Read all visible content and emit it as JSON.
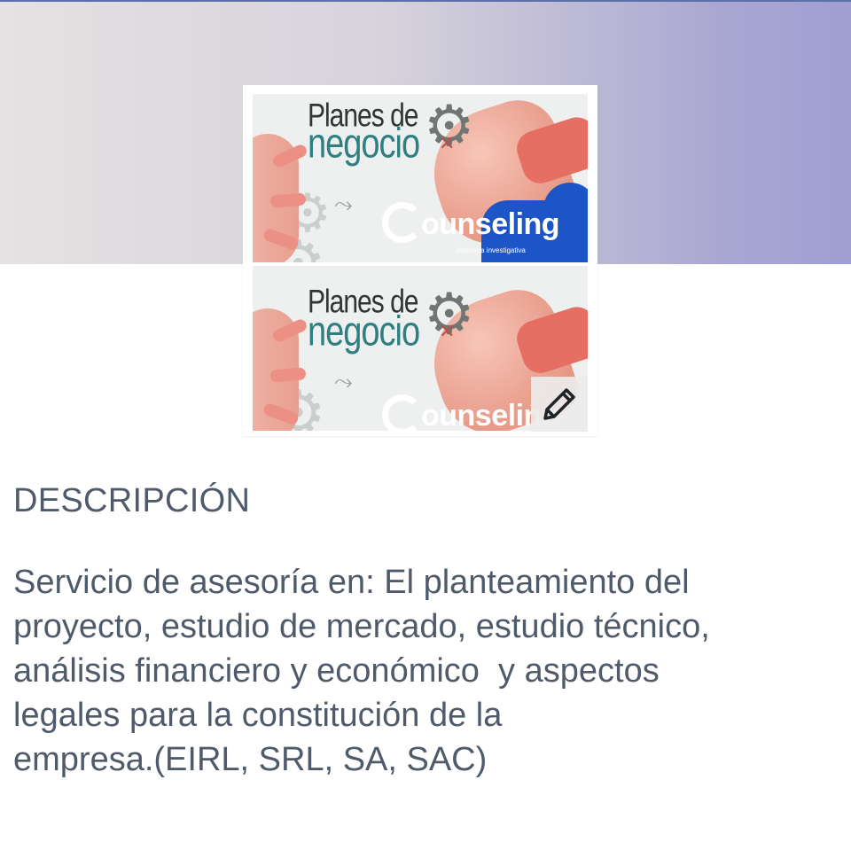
{
  "profile": {
    "photo": {
      "title_line1": "Planes de",
      "title_line2": "negocio",
      "brand_name": "ounseling",
      "brand_tagline": "Asesoría investigativa"
    },
    "edit_icon": "pencil-icon"
  },
  "description": {
    "heading": "DESCRIPCIÓN",
    "text": "Servicio de asesoría en: El planteamiento del\nproyecto, estudio de mercado, estudio técnico,\nanálisis financiero y económico  y aspectos\nlegales para la constitución de la\nempresa.(EIRL, SRL, SA, SAC)"
  },
  "colors": {
    "cover_start": "#e4e2e2",
    "cover_end": "#9f9fd2",
    "text": "#4f5a6a",
    "brand_blue": "#1d55c7",
    "title_teal": "#2f7f80"
  }
}
